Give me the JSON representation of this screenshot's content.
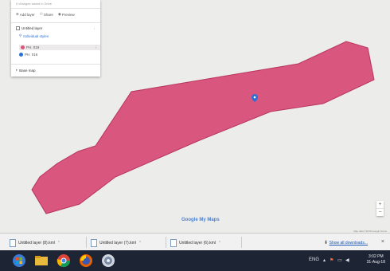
{
  "colors": {
    "polygon_fill": "#d9577f",
    "polygon_stroke": "#b8355e",
    "marker": "#2a6fd6"
  },
  "panel": {
    "subtitle": "0 changes saved in Drive",
    "actions": [
      "Add layer",
      "Share",
      "Preview"
    ],
    "layer_title": "Untitled layer",
    "layer_style": "Individual styles",
    "items": [
      "PH. 019",
      "PH. 016"
    ],
    "base_map": "Base map"
  },
  "map": {
    "logo": "Google My Maps",
    "attribution": "Map data ©2018 Google   Terms",
    "zoom_in": "+",
    "zoom_out": "−"
  },
  "downloads": {
    "items": [
      "Untitled layer (8).kml",
      "Untitled layer (7).kml",
      "Untitled layer (6).kml"
    ],
    "show_all": "Show all downloads...",
    "close": "×"
  },
  "taskbar": {
    "apps": [
      "start-icon",
      "file-explorer-icon",
      "chrome-icon",
      "firefox-icon",
      "media-player-icon"
    ],
    "tray_lang": "ENG",
    "time": "3:02 PM",
    "date": "31-Aug-18"
  }
}
